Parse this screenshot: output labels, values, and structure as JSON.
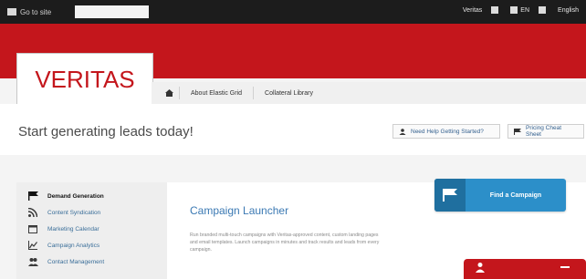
{
  "topbar": {
    "brand_link": "Go to site",
    "search_value": "",
    "items": [
      "Veritas",
      "",
      "EN",
      "",
      "English"
    ]
  },
  "logo": {
    "text": "VERITAS"
  },
  "nav": {
    "links": [
      "About Elastic Grid",
      "Collateral Library"
    ]
  },
  "page": {
    "title": "Start generating leads today!",
    "buttons": [
      "Need Help Getting Started?",
      "Pricing Cheat Sheet"
    ]
  },
  "sidebar": {
    "items": [
      {
        "label": "Demand Generation",
        "icon": "flag-icon",
        "active": true
      },
      {
        "label": "Content Syndication",
        "icon": "rss-icon",
        "active": false
      },
      {
        "label": "Marketing Calendar",
        "icon": "calendar-icon",
        "active": false
      },
      {
        "label": "Campaign Analytics",
        "icon": "chart-icon",
        "active": false
      },
      {
        "label": "Contact Management",
        "icon": "users-icon",
        "active": false
      }
    ]
  },
  "main": {
    "heading": "Campaign Launcher",
    "description": "Run branded multi-touch campaigns with Veritas-approved content, custom landing pages and email templates. Launch campaigns in minutes and track results and leads from every campaign."
  },
  "cta": {
    "label": "Find a Campaign"
  },
  "colors": {
    "brand_red": "#c4161c",
    "accent_blue": "#2c8fc9",
    "link_blue": "#3a6e99"
  }
}
